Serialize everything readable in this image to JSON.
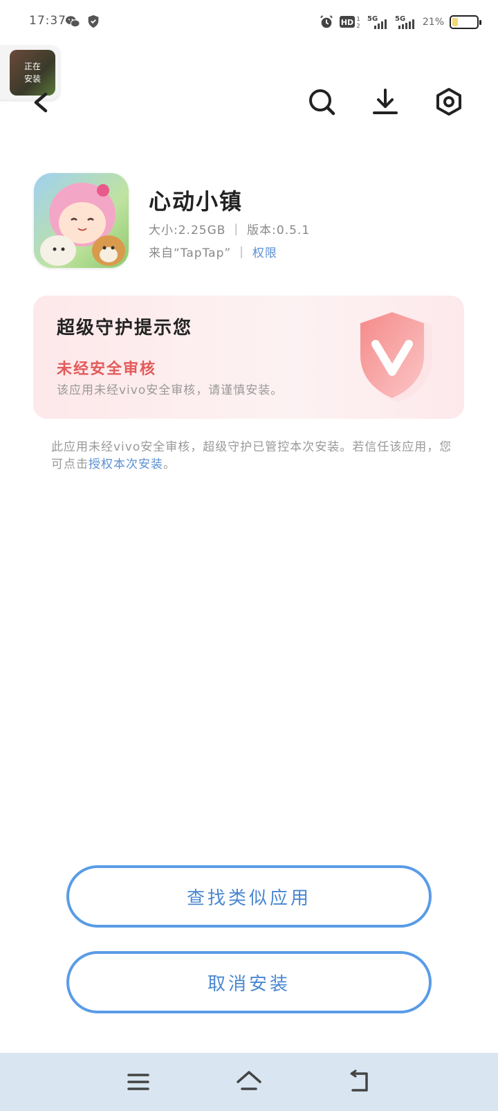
{
  "status_bar": {
    "time": "17:37",
    "battery_percent": "21%",
    "icons": [
      "wechat-icon",
      "shield-icon",
      "alarm-icon",
      "hd-icon",
      "5g-signal-icon",
      "5g-signal-icon",
      "battery-icon"
    ]
  },
  "float_thumb": {
    "label": "正在安装"
  },
  "app": {
    "name": "心动小镇",
    "size": "大小:2.25GB",
    "version": "版本:0.5.1",
    "source": "来自“TapTap”",
    "permissions_link": "权限"
  },
  "warning": {
    "title": "超级守护提示您",
    "headline": "未经安全审核",
    "description": "该应用未经vivo安全审核，请谨慎安装。",
    "accent_color": "#e35a5a"
  },
  "notice": {
    "text_before": "此应用未经vivo安全审核，超级守护已管控本次安装。若信任该应用，您可点击",
    "link": "授权本次安装",
    "text_after": "。"
  },
  "buttons": {
    "find_similar": "查找类似应用",
    "cancel_install": "取消安装"
  },
  "colors": {
    "primary": "#5a9ce6",
    "link": "#5b8fd4",
    "nav_bar": "#d9e6f2"
  }
}
